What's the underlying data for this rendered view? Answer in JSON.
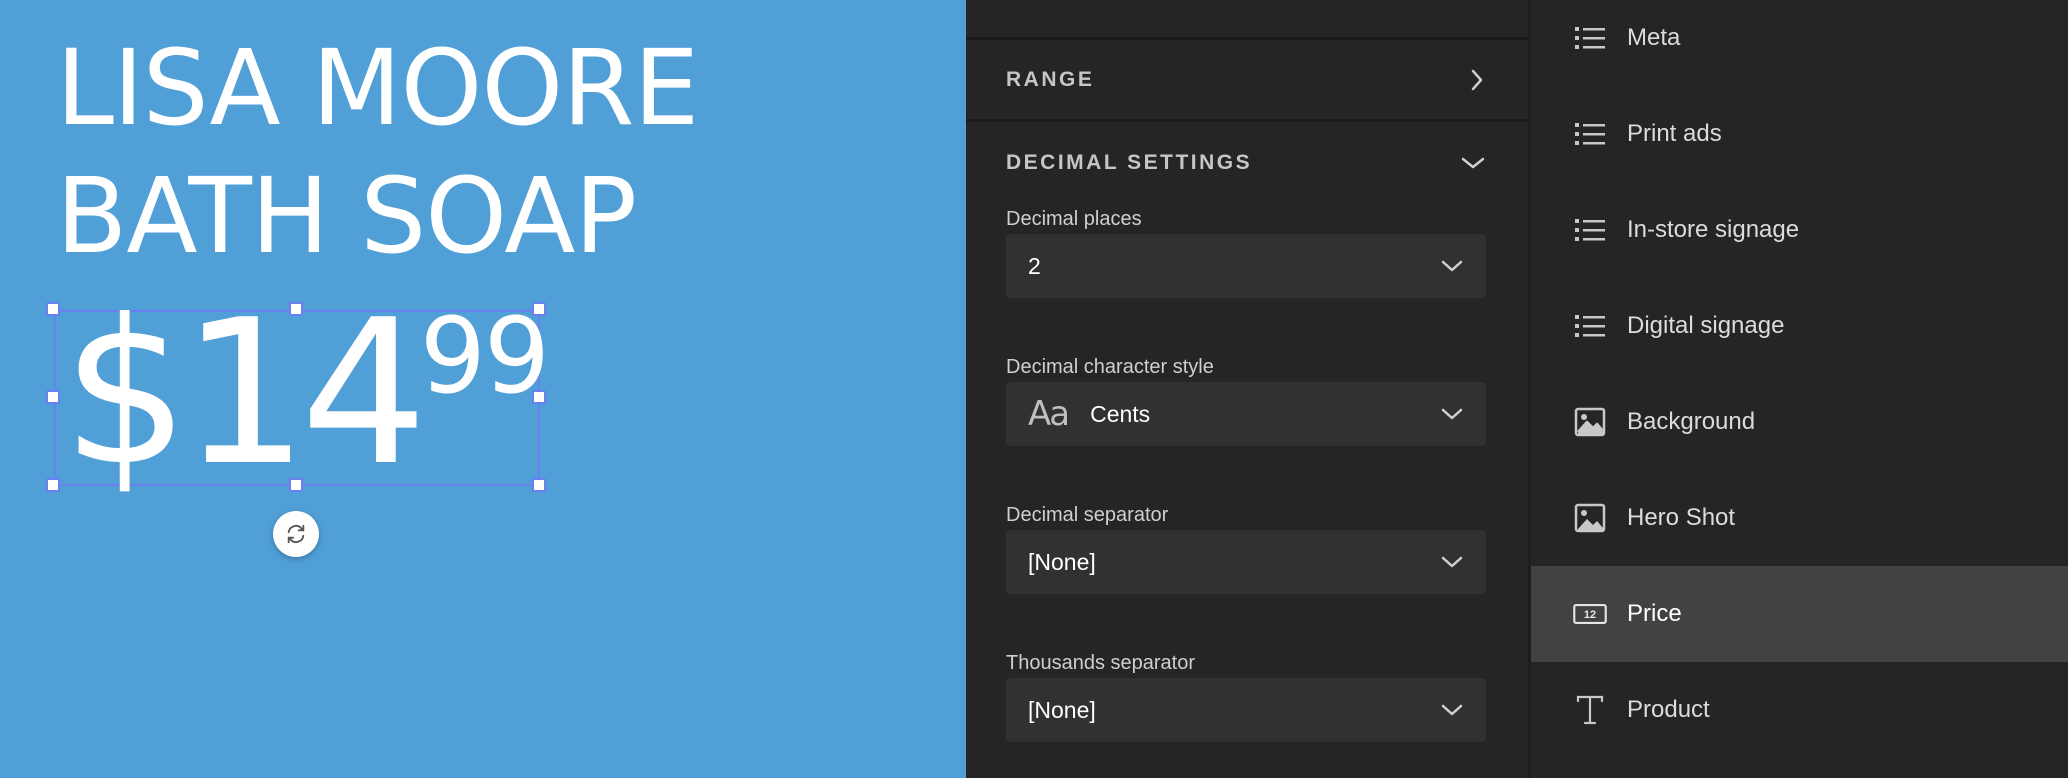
{
  "canvas": {
    "headline_line1": "LISA MOORE",
    "headline_line2": "BATH SOAP",
    "price_main": "$14",
    "price_cents": "99"
  },
  "settings": {
    "range_label": "RANGE",
    "decimal_section_label": "DECIMAL SETTINGS",
    "decimal_places_label": "Decimal places",
    "decimal_places_value": "2",
    "decimal_char_style_label": "Decimal character style",
    "decimal_char_style_glyph": "Aa",
    "decimal_char_style_value": "Cents",
    "decimal_separator_label": "Decimal separator",
    "decimal_separator_value": "[None]",
    "thousands_separator_label": "Thousands separator",
    "thousands_separator_value": "[None]"
  },
  "layers": [
    {
      "label": "Meta",
      "icon": "list-icon"
    },
    {
      "label": "Print ads",
      "icon": "list-icon"
    },
    {
      "label": "In-store signage",
      "icon": "list-icon"
    },
    {
      "label": "Digital signage",
      "icon": "list-icon"
    },
    {
      "label": "Background",
      "icon": "image-icon"
    },
    {
      "label": "Hero Shot",
      "icon": "image-icon"
    },
    {
      "label": "Price",
      "icon": "price-icon",
      "price_icon_text": "12",
      "active": true
    },
    {
      "label": "Product",
      "icon": "text-icon"
    }
  ],
  "colors": {
    "canvas_bg": "#519fd7",
    "selection": "#6a7ff0",
    "panel_bg": "#252525",
    "active_row": "#424242"
  }
}
